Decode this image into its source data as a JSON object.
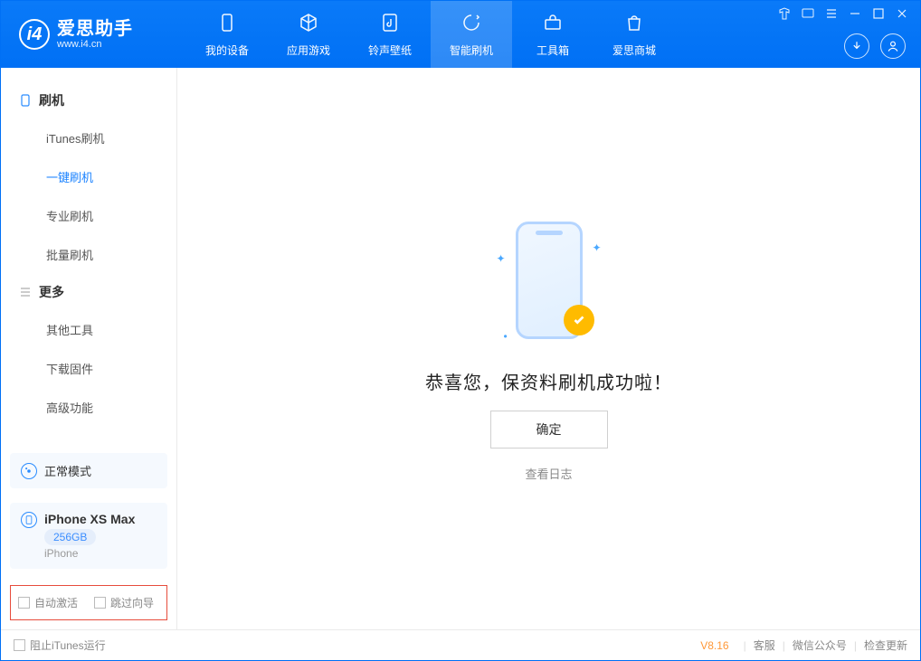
{
  "app": {
    "title": "爱思助手",
    "subtitle": "www.i4.cn"
  },
  "nav": {
    "items": [
      {
        "label": "我的设备"
      },
      {
        "label": "应用游戏"
      },
      {
        "label": "铃声壁纸"
      },
      {
        "label": "智能刷机"
      },
      {
        "label": "工具箱"
      },
      {
        "label": "爱思商城"
      }
    ]
  },
  "sidebar": {
    "section1": {
      "title": "刷机",
      "items": [
        "iTunes刷机",
        "一键刷机",
        "专业刷机",
        "批量刷机"
      ],
      "active_index": 1
    },
    "section2": {
      "title": "更多",
      "items": [
        "其他工具",
        "下载固件",
        "高级功能"
      ]
    },
    "mode_panel": {
      "label": "正常模式"
    },
    "device_panel": {
      "name": "iPhone XS Max",
      "capacity": "256GB",
      "type": "iPhone"
    },
    "checks": {
      "auto_activate": "自动激活",
      "skip_guide": "跳过向导"
    }
  },
  "main": {
    "success_text": "恭喜您，保资料刷机成功啦！",
    "confirm_label": "确定",
    "view_log_label": "查看日志"
  },
  "footer": {
    "block_itunes": "阻止iTunes运行",
    "version": "V8.16",
    "links": [
      "客服",
      "微信公众号",
      "检查更新"
    ]
  }
}
